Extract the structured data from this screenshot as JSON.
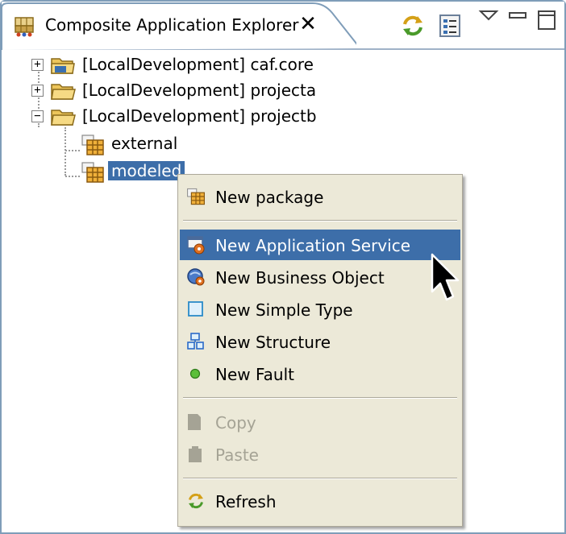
{
  "view": {
    "title": "Composite Application Explorer",
    "close_glyph": "✕",
    "toolbar": [
      "sync-icon",
      "link-with-editor-icon",
      "view-menu-icon",
      "minimize-icon",
      "maximize-icon"
    ]
  },
  "tree": {
    "nodes": [
      {
        "label": "[LocalDevelopment] caf.core",
        "expander": "+",
        "icon": "project-folder-icon"
      },
      {
        "label": "[LocalDevelopment] projecta",
        "expander": "+",
        "icon": "folder-icon"
      },
      {
        "label": "[LocalDevelopment] projectb",
        "expander": "−",
        "icon": "folder-icon"
      },
      {
        "label": "external",
        "icon": "package-icon"
      },
      {
        "label": "modeled",
        "icon": "package-icon",
        "selected": true
      }
    ]
  },
  "context_menu": {
    "new_package": "New package",
    "new_application_service": "New Application Service",
    "new_business_object": "New Business Object",
    "new_simple_type": "New Simple Type",
    "new_structure": "New Structure",
    "new_fault": "New Fault",
    "copy": "Copy",
    "paste": "Paste",
    "refresh": "Refresh",
    "highlighted_item": "New Application Service",
    "disabled_items": [
      "Copy",
      "Paste"
    ]
  },
  "colors": {
    "selection": "#3d6ea9",
    "menu_bg": "#ece9d8",
    "border": "#7f9db9"
  }
}
